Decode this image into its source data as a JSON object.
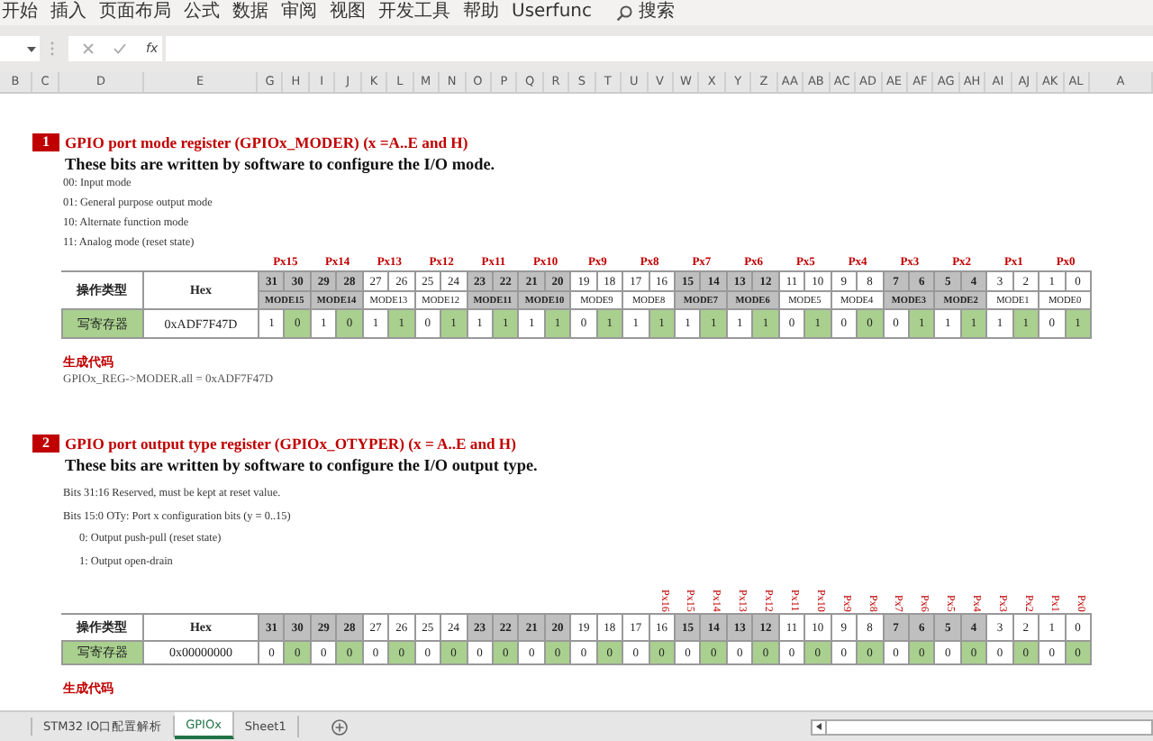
{
  "ribbon": {
    "tabs": [
      "开始",
      "插入",
      "页面布局",
      "公式",
      "数据",
      "审阅",
      "视图",
      "开发工具",
      "帮助",
      "Userfunc"
    ],
    "search": "搜索"
  },
  "formula_bar": {
    "function_label": "fx"
  },
  "column_headers": [
    "B",
    "C",
    "D",
    "E",
    "G",
    "H",
    "I",
    "J",
    "K",
    "L",
    "M",
    "N",
    "O",
    "P",
    "Q",
    "R",
    "S",
    "T",
    "U",
    "V",
    "W",
    "X",
    "Y",
    "Z",
    "AA",
    "AB",
    "AC",
    "AD",
    "AE",
    "AF",
    "AG",
    "AH",
    "AI",
    "AJ",
    "AK",
    "AL",
    "A"
  ],
  "sections": [
    {
      "number": "1",
      "title": "GPIO port mode register (GPIOx_MODER) (x =A..E and H)",
      "subtitle": "These bits are written by software to configure the I/O mode.",
      "notes": [
        {
          "text": "00: Input mode"
        },
        {
          "text": "01: General purpose output mode"
        },
        {
          "text": "10: Alternate function mode"
        },
        {
          "text": "11: Analog mode (reset state)"
        }
      ],
      "register": {
        "kind": "upright",
        "pin_labels": [
          "Px15",
          "Px14",
          "Px13",
          "Px12",
          "Px11",
          "Px10",
          "Px9",
          "Px8",
          "Px7",
          "Px6",
          "Px5",
          "Px4",
          "Px3",
          "Px2",
          "Px1",
          "Px0"
        ],
        "header_label": "操作类型",
        "hex_header": "Hex",
        "bits": [
          {
            "label": "31",
            "shaded": true
          },
          {
            "label": "30",
            "shaded": true
          },
          {
            "label": "29",
            "shaded": true
          },
          {
            "label": "28",
            "shaded": true
          },
          {
            "label": "27",
            "shaded": false
          },
          {
            "label": "26",
            "shaded": false
          },
          {
            "label": "25",
            "shaded": false
          },
          {
            "label": "24",
            "shaded": false
          },
          {
            "label": "23",
            "shaded": true
          },
          {
            "label": "22",
            "shaded": true
          },
          {
            "label": "21",
            "shaded": true
          },
          {
            "label": "20",
            "shaded": true
          },
          {
            "label": "19",
            "shaded": false
          },
          {
            "label": "18",
            "shaded": false
          },
          {
            "label": "17",
            "shaded": false
          },
          {
            "label": "16",
            "shaded": false
          },
          {
            "label": "15",
            "shaded": true
          },
          {
            "label": "14",
            "shaded": true
          },
          {
            "label": "13",
            "shaded": true
          },
          {
            "label": "12",
            "shaded": true
          },
          {
            "label": "11",
            "shaded": false
          },
          {
            "label": "10",
            "shaded": false
          },
          {
            "label": "9",
            "shaded": false
          },
          {
            "label": "8",
            "shaded": false
          },
          {
            "label": "7",
            "shaded": true
          },
          {
            "label": "6",
            "shaded": true
          },
          {
            "label": "5",
            "shaded": true
          },
          {
            "label": "4",
            "shaded": true
          },
          {
            "label": "3",
            "shaded": false
          },
          {
            "label": "2",
            "shaded": false
          },
          {
            "label": "1",
            "shaded": false
          },
          {
            "label": "0",
            "shaded": false
          }
        ],
        "fields": [
          {
            "label": "MODE15",
            "shaded": true
          },
          {
            "label": "MODE14",
            "shaded": true
          },
          {
            "label": "MODE13",
            "shaded": false
          },
          {
            "label": "MODE12",
            "shaded": false
          },
          {
            "label": "MODE11",
            "shaded": true
          },
          {
            "label": "MODE10",
            "shaded": true
          },
          {
            "label": "MODE9",
            "shaded": false
          },
          {
            "label": "MODE8",
            "shaded": false
          },
          {
            "label": "MODE7",
            "shaded": true
          },
          {
            "label": "MODE6",
            "shaded": true
          },
          {
            "label": "MODE5",
            "shaded": false
          },
          {
            "label": "MODE4",
            "shaded": false
          },
          {
            "label": "MODE3",
            "shaded": true
          },
          {
            "label": "MODE2",
            "shaded": true
          },
          {
            "label": "MODE1",
            "shaded": false
          },
          {
            "label": "MODE0",
            "shaded": false
          }
        ],
        "row_label": "写寄存器",
        "hex_value": "0xADF7F47D",
        "values": [
          {
            "text": "1",
            "highlighted": false
          },
          {
            "text": "0",
            "highlighted": true
          },
          {
            "text": "1",
            "highlighted": false
          },
          {
            "text": "0",
            "highlighted": true
          },
          {
            "text": "1",
            "highlighted": false
          },
          {
            "text": "1",
            "highlighted": true
          },
          {
            "text": "0",
            "highlighted": false
          },
          {
            "text": "1",
            "highlighted": true
          },
          {
            "text": "1",
            "highlighted": false
          },
          {
            "text": "1",
            "highlighted": true
          },
          {
            "text": "1",
            "highlighted": false
          },
          {
            "text": "1",
            "highlighted": true
          },
          {
            "text": "0",
            "highlighted": false
          },
          {
            "text": "1",
            "highlighted": true
          },
          {
            "text": "1",
            "highlighted": false
          },
          {
            "text": "1",
            "highlighted": true
          },
          {
            "text": "1",
            "highlighted": false
          },
          {
            "text": "1",
            "highlighted": true
          },
          {
            "text": "1",
            "highlighted": false
          },
          {
            "text": "1",
            "highlighted": true
          },
          {
            "text": "0",
            "highlighted": false
          },
          {
            "text": "1",
            "highlighted": true
          },
          {
            "text": "0",
            "highlighted": false
          },
          {
            "text": "0",
            "highlighted": true
          },
          {
            "text": "0",
            "highlighted": false
          },
          {
            "text": "1",
            "highlighted": true
          },
          {
            "text": "1",
            "highlighted": false
          },
          {
            "text": "1",
            "highlighted": true
          },
          {
            "text": "1",
            "highlighted": false
          },
          {
            "text": "1",
            "highlighted": true
          },
          {
            "text": "0",
            "highlighted": false
          },
          {
            "text": "1",
            "highlighted": true
          }
        ]
      },
      "code_label": "生成代码",
      "code": "GPIOx_REG->MODER.all = 0xADF7F47D"
    },
    {
      "number": "2",
      "title": "GPIO port output type register (GPIOx_OTYPER) (x = A..E and H)",
      "subtitle": "These bits are written by software to configure the I/O output type.",
      "notes": [
        {
          "text": "Bits 31:16 Reserved, must be kept at reset value."
        },
        {
          "text": "Bits 15:0 OTy: Port x configuration bits (y = 0..15)",
          "children": [
            {
              "text": "0: Output push-pull (reset state)"
            },
            {
              "text": "1: Output open-drain"
            }
          ]
        }
      ],
      "register": {
        "kind": "rotated",
        "pin_labels": [
          "Px16",
          "Px15",
          "Px14",
          "Px13",
          "Px12",
          "Px11",
          "Px10",
          "Px9",
          "Px8",
          "Px7",
          "Px6",
          "Px5",
          "Px4",
          "Px3",
          "Px2",
          "Px1",
          "Px0"
        ],
        "header_label": "操作类型",
        "hex_header": "Hex",
        "bits": [
          {
            "label": "31",
            "shaded": true
          },
          {
            "label": "30",
            "shaded": true
          },
          {
            "label": "29",
            "shaded": true
          },
          {
            "label": "28",
            "shaded": true
          },
          {
            "label": "27",
            "shaded": false
          },
          {
            "label": "26",
            "shaded": false
          },
          {
            "label": "25",
            "shaded": false
          },
          {
            "label": "24",
            "shaded": false
          },
          {
            "label": "23",
            "shaded": true
          },
          {
            "label": "22",
            "shaded": true
          },
          {
            "label": "21",
            "shaded": true
          },
          {
            "label": "20",
            "shaded": true
          },
          {
            "label": "19",
            "shaded": false
          },
          {
            "label": "18",
            "shaded": false
          },
          {
            "label": "17",
            "shaded": false
          },
          {
            "label": "16",
            "shaded": false
          },
          {
            "label": "15",
            "shaded": true
          },
          {
            "label": "14",
            "shaded": true
          },
          {
            "label": "13",
            "shaded": true
          },
          {
            "label": "12",
            "shaded": true
          },
          {
            "label": "11",
            "shaded": false
          },
          {
            "label": "10",
            "shaded": false
          },
          {
            "label": "9",
            "shaded": false
          },
          {
            "label": "8",
            "shaded": false
          },
          {
            "label": "7",
            "shaded": true
          },
          {
            "label": "6",
            "shaded": true
          },
          {
            "label": "5",
            "shaded": true
          },
          {
            "label": "4",
            "shaded": true
          },
          {
            "label": "3",
            "shaded": false
          },
          {
            "label": "2",
            "shaded": false
          },
          {
            "label": "1",
            "shaded": false
          },
          {
            "label": "0",
            "shaded": false
          }
        ],
        "row_label": "写寄存器",
        "hex_value": "0x00000000",
        "values": [
          {
            "text": "0",
            "highlighted": false
          },
          {
            "text": "0",
            "highlighted": true
          },
          {
            "text": "0",
            "highlighted": false
          },
          {
            "text": "0",
            "highlighted": true
          },
          {
            "text": "0",
            "highlighted": false
          },
          {
            "text": "0",
            "highlighted": true
          },
          {
            "text": "0",
            "highlighted": false
          },
          {
            "text": "0",
            "highlighted": true
          },
          {
            "text": "0",
            "highlighted": false
          },
          {
            "text": "0",
            "highlighted": true
          },
          {
            "text": "0",
            "highlighted": false
          },
          {
            "text": "0",
            "highlighted": true
          },
          {
            "text": "0",
            "highlighted": false
          },
          {
            "text": "0",
            "highlighted": true
          },
          {
            "text": "0",
            "highlighted": false
          },
          {
            "text": "0",
            "highlighted": true
          },
          {
            "text": "0",
            "highlighted": false
          },
          {
            "text": "0",
            "highlighted": true
          },
          {
            "text": "0",
            "highlighted": false
          },
          {
            "text": "0",
            "highlighted": true
          },
          {
            "text": "0",
            "highlighted": false
          },
          {
            "text": "0",
            "highlighted": true
          },
          {
            "text": "0",
            "highlighted": false
          },
          {
            "text": "0",
            "highlighted": true
          },
          {
            "text": "0",
            "highlighted": false
          },
          {
            "text": "0",
            "highlighted": true
          },
          {
            "text": "0",
            "highlighted": false
          },
          {
            "text": "0",
            "highlighted": true
          },
          {
            "text": "0",
            "highlighted": false
          },
          {
            "text": "0",
            "highlighted": true
          },
          {
            "text": "0",
            "highlighted": false
          },
          {
            "text": "0",
            "highlighted": true
          }
        ]
      },
      "code_label": "生成代码"
    }
  ],
  "sheet_tabs": [
    {
      "label": "STM32 IO口配置解析",
      "selected": false
    },
    {
      "label": "GPIOx",
      "selected": true
    },
    {
      "label": "Sheet1",
      "selected": false
    }
  ]
}
